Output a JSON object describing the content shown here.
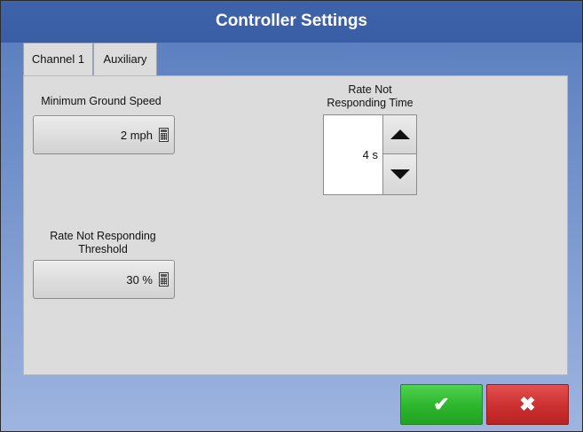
{
  "window": {
    "title": "Controller Settings"
  },
  "tabs": [
    {
      "label": "Channel 1",
      "active": false
    },
    {
      "label": "Auxiliary",
      "active": true
    }
  ],
  "settings": {
    "min_ground_speed": {
      "label": "Minimum Ground Speed",
      "value": "2 mph",
      "icon": "calculator-icon"
    },
    "rate_not_responding_threshold": {
      "label_line1": "Rate Not Responding",
      "label_line2": "Threshold",
      "value": "30 %",
      "icon": "calculator-icon"
    },
    "rate_not_responding_time": {
      "label_line1": "Rate Not",
      "label_line2": "Responding Time",
      "value": "4 s",
      "up_icon": "arrow-up-icon",
      "down_icon": "arrow-down-icon"
    }
  },
  "actions": {
    "ok_glyph": "✔",
    "cancel_glyph": "✖",
    "ok_color": "#2db52d",
    "cancel_color": "#cc2f2f"
  },
  "colors": {
    "title_bar": "#3f63a9",
    "panel": "#dcdcdc"
  }
}
